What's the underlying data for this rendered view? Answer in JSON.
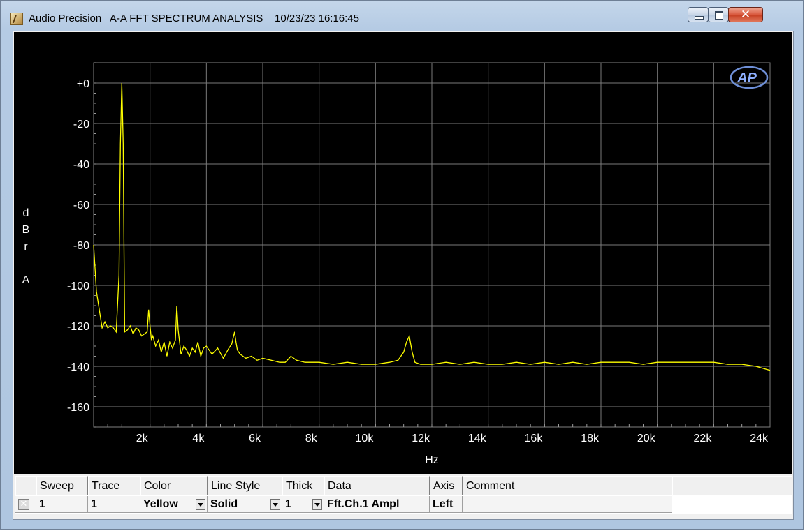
{
  "window": {
    "title": "Audio Precision   A-A FFT SPECTRUM ANALYSIS    10/23/23 16:16:45",
    "controls": {
      "minimize_icon": "minimize-icon",
      "maximize_icon": "maximize-icon",
      "close_icon": "close-icon",
      "close_glyph": "✕"
    }
  },
  "logo": "AP",
  "chart_data": {
    "type": "line",
    "xlabel": "Hz",
    "ylabel_letters": [
      "d",
      "B",
      "r",
      "",
      "A"
    ],
    "xlim": [
      0,
      24000
    ],
    "ylim": [
      -170,
      10
    ],
    "x_ticks": [
      2000,
      4000,
      6000,
      8000,
      10000,
      12000,
      14000,
      16000,
      18000,
      20000,
      22000,
      24000
    ],
    "x_tick_labels": [
      "2k",
      "4k",
      "6k",
      "8k",
      "10k",
      "12k",
      "14k",
      "16k",
      "18k",
      "20k",
      "22k",
      "24k"
    ],
    "y_ticks": [
      0,
      -20,
      -40,
      -60,
      -80,
      -100,
      -120,
      -140,
      -160
    ],
    "y_tick_labels": [
      "+0",
      "-20",
      "-40",
      "-60",
      "-80",
      "-100",
      "-120",
      "-140",
      "-160"
    ],
    "grid": true,
    "series": [
      {
        "color": "#ffff00",
        "x": [
          0,
          100,
          200,
          300,
          400,
          500,
          600,
          700,
          800,
          900,
          950,
          1000,
          1050,
          1100,
          1200,
          1300,
          1400,
          1500,
          1600,
          1700,
          1800,
          1900,
          1950,
          2000,
          2050,
          2100,
          2200,
          2300,
          2400,
          2500,
          2600,
          2700,
          2800,
          2900,
          2950,
          3000,
          3050,
          3100,
          3200,
          3300,
          3400,
          3500,
          3600,
          3700,
          3800,
          3900,
          4000,
          4200,
          4400,
          4600,
          4800,
          4900,
          5000,
          5050,
          5100,
          5200,
          5400,
          5600,
          5800,
          6000,
          6300,
          6600,
          6800,
          7000,
          7200,
          7500,
          8000,
          8500,
          9000,
          9500,
          10000,
          10500,
          10800,
          11000,
          11100,
          11200,
          11300,
          11400,
          11600,
          12000,
          12500,
          13000,
          13500,
          14000,
          14500,
          15000,
          15500,
          16000,
          16500,
          17000,
          17500,
          18000,
          18500,
          19000,
          19500,
          20000,
          20500,
          21000,
          21500,
          22000,
          22500,
          23000,
          23500,
          24000
        ],
        "y": [
          -80,
          -103,
          -112,
          -121,
          -118,
          -121,
          -120,
          -121,
          -123,
          -95,
          -30,
          0,
          -30,
          -123,
          -122,
          -120,
          -124,
          -121,
          -122,
          -125,
          -124,
          -123,
          -112,
          -120,
          -127,
          -125,
          -130,
          -127,
          -133,
          -128,
          -135,
          -128,
          -131,
          -127,
          -110,
          -122,
          -128,
          -134,
          -130,
          -132,
          -135,
          -131,
          -133,
          -128,
          -135,
          -131,
          -130,
          -134,
          -131,
          -136,
          -131,
          -129,
          -123,
          -128,
          -132,
          -134,
          -136,
          -135,
          -137,
          -136,
          -137,
          -138,
          -138,
          -135,
          -137,
          -138,
          -138,
          -139,
          -138,
          -139,
          -139,
          -138,
          -137,
          -133,
          -128,
          -125,
          -133,
          -138,
          -139,
          -139,
          -138,
          -139,
          -138,
          -139,
          -139,
          -138,
          -139,
          -138,
          -139,
          -138,
          -139,
          -138,
          -138,
          -138,
          -139,
          -138,
          -138,
          -138,
          -138,
          -138,
          -139,
          -139,
          -140,
          -142
        ]
      }
    ]
  },
  "trace_table": {
    "headers": [
      "Sweep",
      "Trace",
      "Color",
      "Line Style",
      "Thick",
      "Data",
      "Axis",
      "Comment"
    ],
    "row": {
      "close_glyph": "✕",
      "sweep": "1",
      "trace": "1",
      "color": "Yellow",
      "line_style": "Solid",
      "thick": "1",
      "data": "Fft.Ch.1 Ampl",
      "axis": "Left",
      "comment": ""
    }
  }
}
